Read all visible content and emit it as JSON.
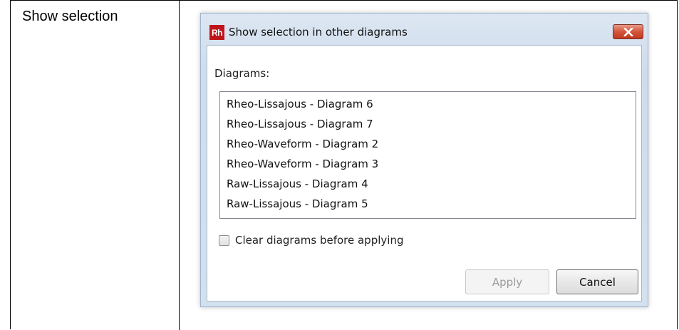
{
  "document": {
    "cell_label": "Show selection"
  },
  "dialog": {
    "app_icon_text": "Rh",
    "title": "Show selection in other diagrams",
    "diagrams_label": "Diagrams:",
    "diagrams": [
      "Rheo-Lissajous - Diagram 6",
      "Rheo-Lissajous - Diagram 7",
      "Rheo-Waveform - Diagram 2",
      "Rheo-Waveform - Diagram 3",
      "Raw-Lissajous - Diagram 4",
      "Raw-Lissajous - Diagram 5"
    ],
    "clear_checkbox_label": "Clear diagrams before applying",
    "clear_checkbox_checked": false,
    "apply_label": "Apply",
    "apply_enabled": false,
    "cancel_label": "Cancel"
  },
  "colors": {
    "app_icon_bg": "#c0141b",
    "close_button": "#c23a22",
    "dialog_frame": "#d3e0ee"
  }
}
